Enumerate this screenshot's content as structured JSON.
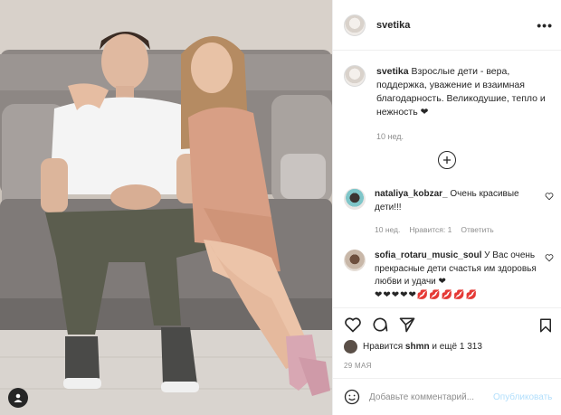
{
  "post": {
    "username": "svetika",
    "caption_text": "Взрослые дети - вера, поддержка, уважение и взаимная благодарность. Великодушие, тепло и нежность ❤",
    "caption_time": "10 нед.",
    "likes_prefix": "Нравится",
    "likes_user": "shmn",
    "likes_suffix": "и ещё 1 313",
    "date": "29 МАЯ"
  },
  "comments": [
    {
      "username": "nataliya_kobzar_",
      "text": "Очень красивые дети!!!",
      "time": "10 нед.",
      "likes": "Нравится: 1",
      "reply": "Ответить"
    },
    {
      "username": "sofia_rotaru_music_soul",
      "text": "У Вас очень прекрасные дети счастья им здоровья любви и удачи ❤",
      "emoji_line": "❤❤❤❤❤💋💋💋💋💋"
    }
  ],
  "add_comment": {
    "placeholder": "Добавьте комментарий...",
    "publish_label": "Опубликовать"
  },
  "icons": [
    "more-icon",
    "plus-circle-icon",
    "heart-icon",
    "comment-icon",
    "share-icon",
    "bookmark-icon",
    "emoji-icon",
    "user-tag-icon"
  ],
  "colors": {
    "accent_heart": "#ed4956",
    "link_disabled": "#b2dffc",
    "muted": "#8e8e8e"
  }
}
